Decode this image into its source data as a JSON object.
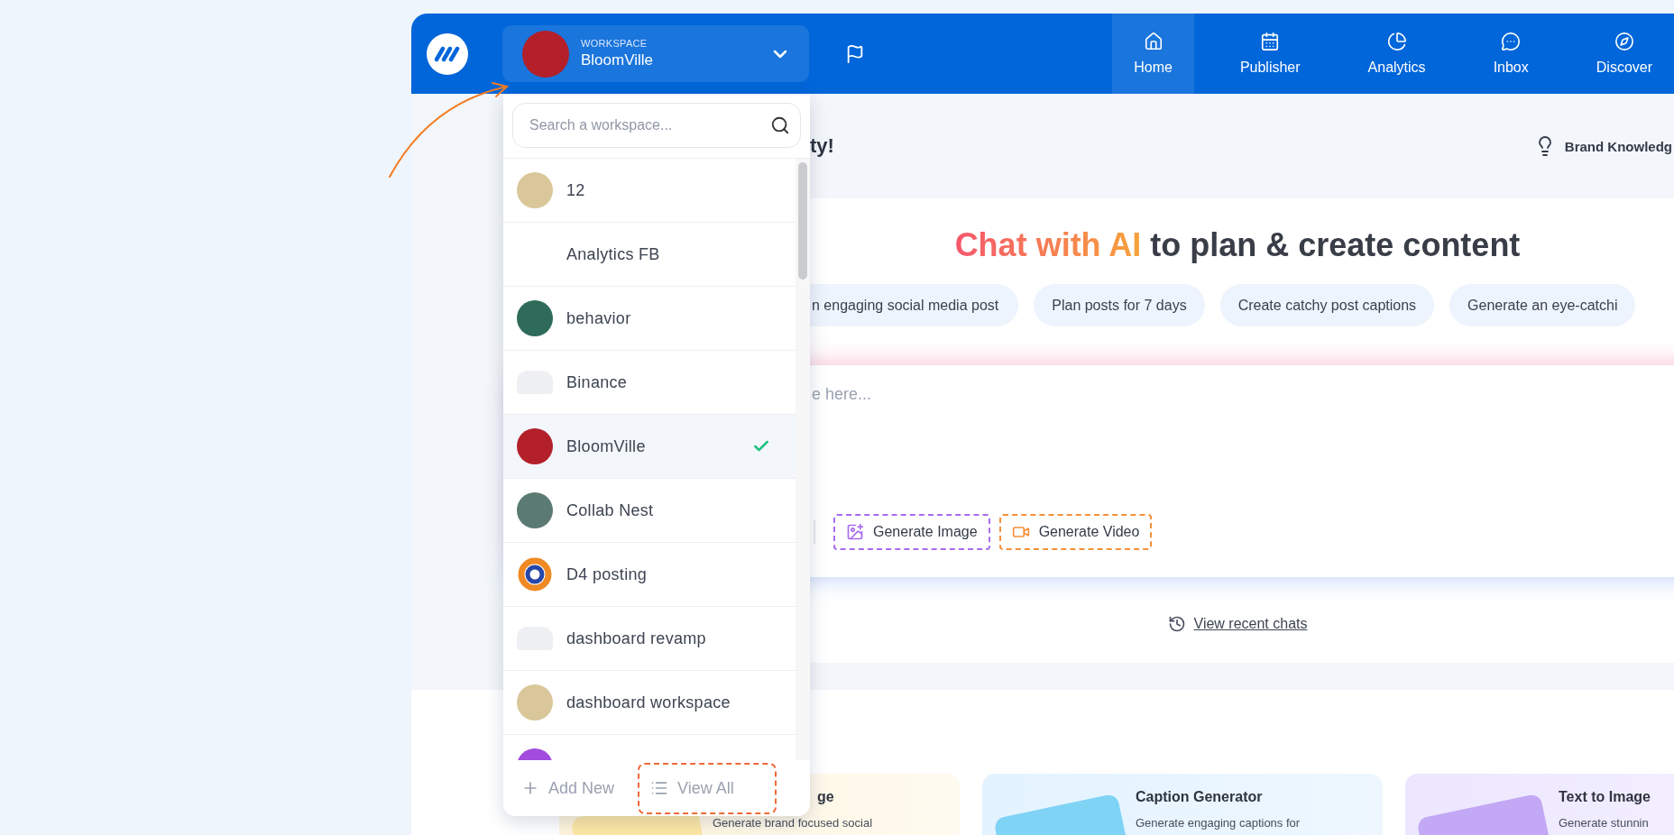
{
  "topbar": {
    "workspace": {
      "label": "WORKSPACE",
      "name": "BloomVille",
      "color": "#b3202a"
    },
    "tabs": [
      {
        "label": "Home",
        "selected": true
      },
      {
        "label": "Publisher",
        "selected": false
      },
      {
        "label": "Analytics",
        "selected": false
      },
      {
        "label": "Inbox",
        "selected": false
      },
      {
        "label": "Discover",
        "selected": false
      }
    ]
  },
  "workspace_menu": {
    "search_placeholder": "Search a workspace...",
    "items": [
      {
        "name": "12",
        "kind": "photo",
        "color": "#d9c79a",
        "selected": false
      },
      {
        "name": "Analytics FB",
        "kind": "none",
        "selected": false
      },
      {
        "name": "behavior",
        "kind": "photo",
        "color": "#2f6b5a",
        "selected": false
      },
      {
        "name": "Binance",
        "kind": "placeholder",
        "selected": false
      },
      {
        "name": "BloomVille",
        "kind": "photo",
        "color": "#b3202a",
        "selected": true
      },
      {
        "name": "Collab Nest",
        "kind": "photo",
        "color": "#5b7a73",
        "selected": false
      },
      {
        "name": "D4 posting",
        "kind": "logo",
        "selected": false
      },
      {
        "name": "dashboard revamp",
        "kind": "placeholder",
        "selected": false
      },
      {
        "name": "dashboard workspace",
        "kind": "photo",
        "color": "#d9c79a",
        "selected": false
      },
      {
        "kind": "photo",
        "color": "#a24bdc",
        "selected": false
      }
    ],
    "footer": [
      {
        "label": "Add New",
        "kind": "add"
      },
      {
        "label": "View All",
        "kind": "view"
      }
    ]
  },
  "greeting": "ty!",
  "brand_knowledge": "Brand Knowledg",
  "chat": {
    "title_highlight": "Chat with AI",
    "title_rest": "to plan & create content",
    "prompts": [
      "n engaging social media post",
      "Plan posts for 7 days",
      "Create catchy post captions",
      "Generate an eye-catchi"
    ],
    "placeholder": "e here...",
    "actions": [
      {
        "label": "Generate Image",
        "kind": "image"
      },
      {
        "label": "Generate Video",
        "kind": "video"
      }
    ],
    "recent_link": "View recent chats"
  },
  "tools": [
    {
      "title": "ge",
      "description": "Generate brand focused social",
      "kind": "brand"
    },
    {
      "title": "Caption Generator",
      "description": "Generate engaging captions for",
      "kind": "caption"
    },
    {
      "title": "Text to Image",
      "description": "Generate stunnin",
      "kind": "image"
    }
  ]
}
